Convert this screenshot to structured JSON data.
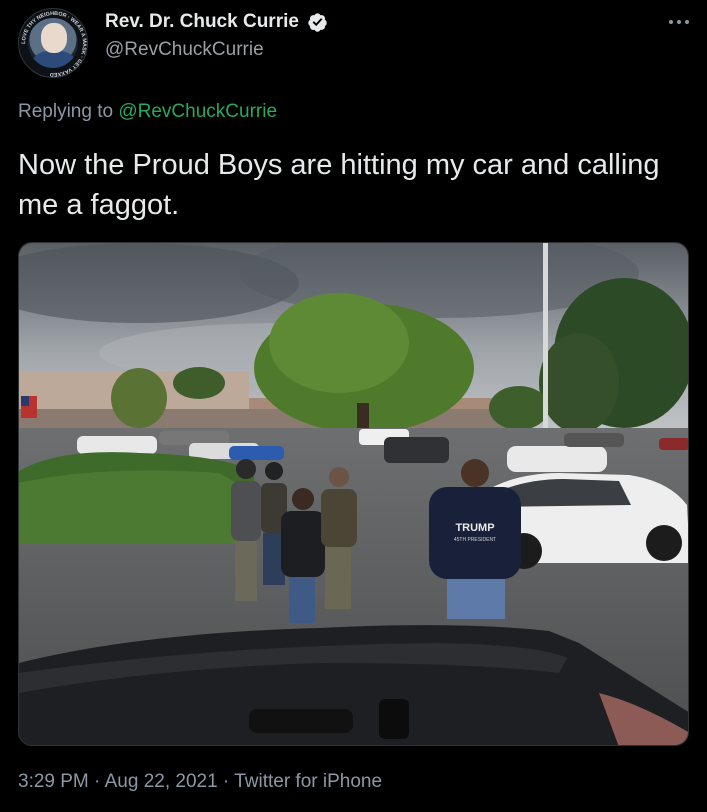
{
  "author": {
    "display_name": "Rev. Dr. Chuck Currie",
    "handle": "@RevChuckCurrie",
    "verified": true,
    "avatar_ring_text": "LOVE THY NEIGHBOR · WEAR A MASK · GET VAXXED"
  },
  "reply": {
    "prefix": "Replying to",
    "target": "@RevChuckCurrie"
  },
  "tweet": {
    "text": "Now the Proud Boys are hitting my car and calling me a faggot."
  },
  "photo": {
    "shirt_text": "TRUMP",
    "shirt_subtext": "45TH PRESIDENT"
  },
  "meta": {
    "time": "3:29 PM",
    "separator": " · ",
    "date": "Aug 22, 2021",
    "source": "Twitter for iPhone"
  },
  "colors": {
    "background": "#000000",
    "text": "#e7e9ea",
    "secondary": "#8b98a5",
    "link": "#2aa95a",
    "verified": "#e7e9ea"
  },
  "icons": {
    "verified": "verified-badge-icon",
    "more": "more-horizontal-icon"
  }
}
